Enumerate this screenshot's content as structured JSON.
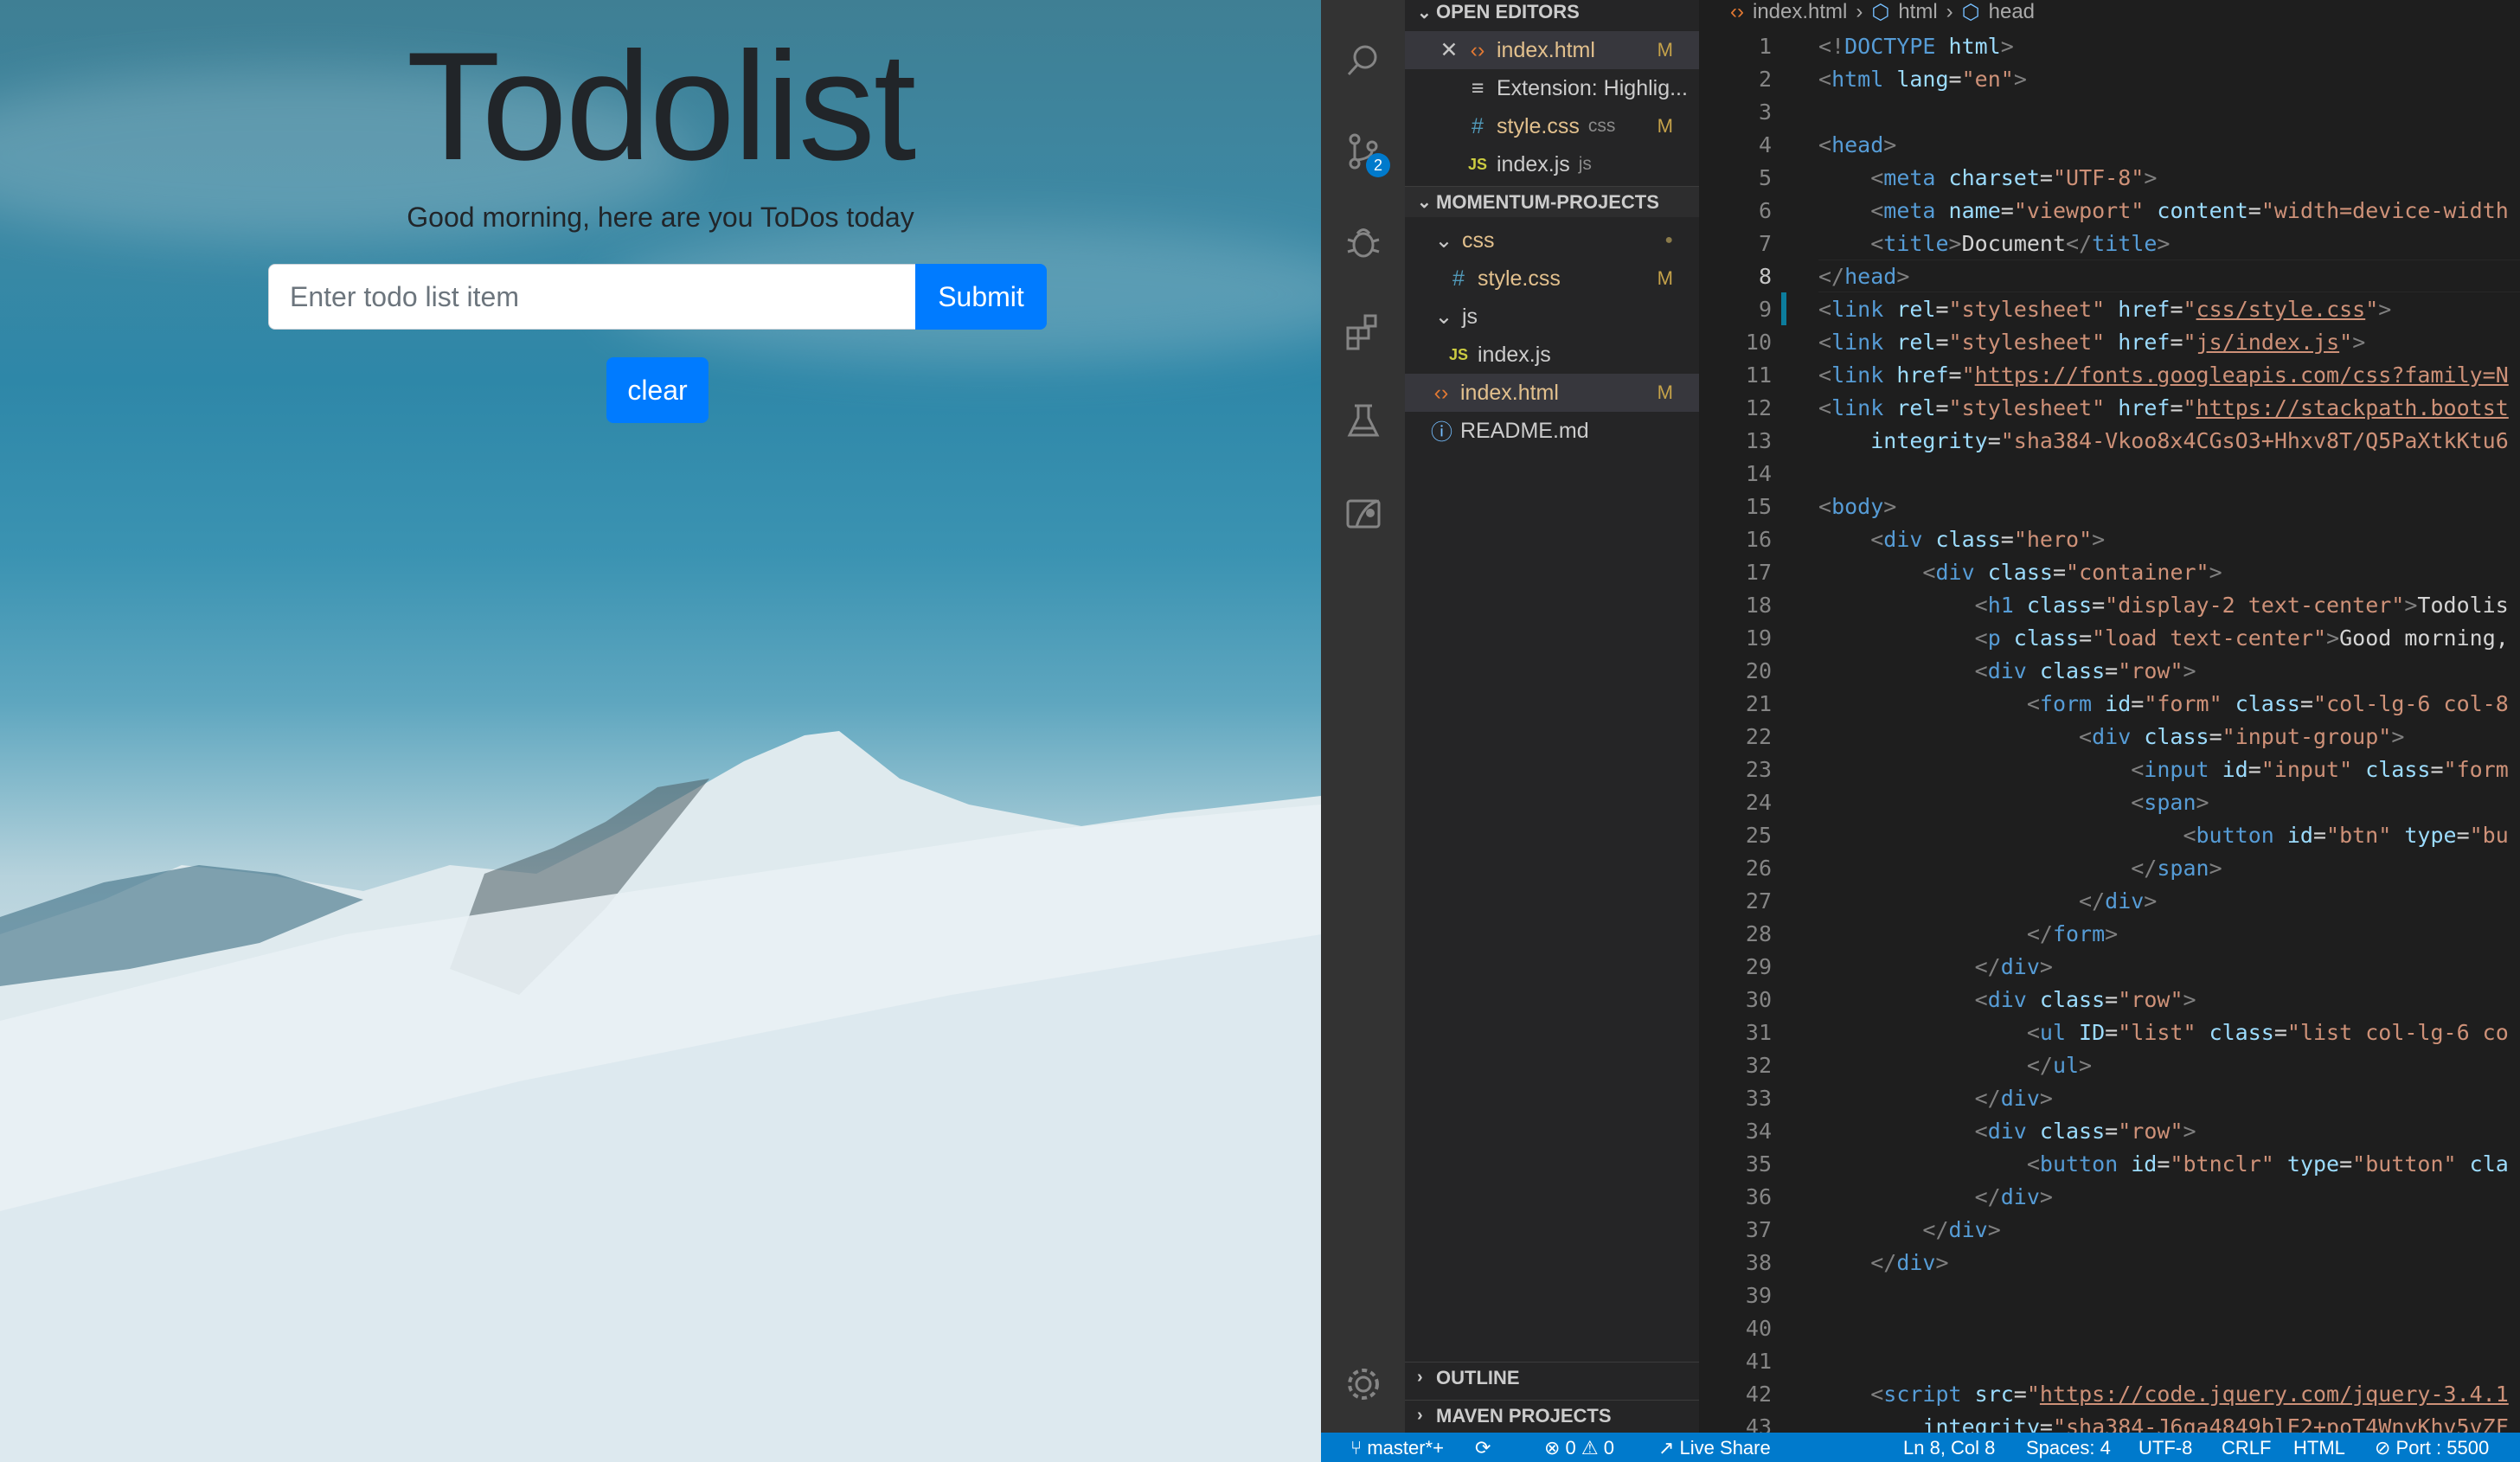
{
  "preview": {
    "title": "Todolist",
    "subtitle": "Good morning, here are you ToDos today",
    "input_placeholder": "Enter todo list item",
    "submit_label": "Submit",
    "clear_label": "clear"
  },
  "colors": {
    "accent": "#007bff",
    "statusbar": "#007acc",
    "editor_bg": "#1e1e1e",
    "sidebar_bg": "#252526"
  },
  "activity_bar": {
    "icons": [
      "search-icon",
      "source-control-icon",
      "debug-icon",
      "extensions-icon",
      "testing-icon",
      "remote-explorer-icon",
      "settings-gear-icon"
    ],
    "source_control_badge": "2"
  },
  "explorer": {
    "open_editors_header": "OPEN EDITORS",
    "open_editors": [
      {
        "name": "index.html",
        "badge": "M",
        "close": "✕"
      },
      {
        "name": "Extension: Highlig...",
        "badge": ""
      },
      {
        "name": "style.css",
        "hint": "css",
        "badge": "M"
      },
      {
        "name": "index.js",
        "hint": "js",
        "badge": ""
      }
    ],
    "project_header": "MOMENTUM-PROJECTS",
    "tree": [
      {
        "name": "css",
        "badge": "●"
      },
      {
        "name": "style.css",
        "badge": "M"
      },
      {
        "name": "js",
        "badge": ""
      },
      {
        "name": "index.js",
        "badge": ""
      },
      {
        "name": "index.html",
        "badge": "M"
      },
      {
        "name": "README.md",
        "badge": ""
      }
    ],
    "outline_header": "OUTLINE",
    "maven_header": "MAVEN PROJECTS"
  },
  "breadcrumbs": [
    "index.html",
    "html",
    "head"
  ],
  "code_lines": [
    [
      [
        "pu",
        "<!"
      ],
      [
        "t",
        "DOCTYPE "
      ],
      [
        "a",
        "html"
      ],
      [
        "pu",
        ">"
      ]
    ],
    [
      [
        "pu",
        "<"
      ],
      [
        "t",
        "html "
      ],
      [
        "a",
        "lang"
      ],
      [
        "tx",
        "="
      ],
      [
        "s",
        "\"en\""
      ],
      [
        "pu",
        ">"
      ]
    ],
    [],
    [
      [
        "pu",
        "<"
      ],
      [
        "t",
        "head"
      ],
      [
        "pu",
        ">"
      ]
    ],
    [
      [
        "tx",
        "    "
      ],
      [
        "pu",
        "<"
      ],
      [
        "t",
        "meta "
      ],
      [
        "a",
        "charset"
      ],
      [
        "tx",
        "="
      ],
      [
        "s",
        "\"UTF-8\""
      ],
      [
        "pu",
        ">"
      ]
    ],
    [
      [
        "tx",
        "    "
      ],
      [
        "pu",
        "<"
      ],
      [
        "t",
        "meta "
      ],
      [
        "a",
        "name"
      ],
      [
        "tx",
        "="
      ],
      [
        "s",
        "\"viewport\" "
      ],
      [
        "a",
        "content"
      ],
      [
        "tx",
        "="
      ],
      [
        "s",
        "\"width=device-width"
      ]
    ],
    [
      [
        "tx",
        "    "
      ],
      [
        "pu",
        "<"
      ],
      [
        "t",
        "title"
      ],
      [
        "pu",
        ">"
      ],
      [
        "tx",
        "Document"
      ],
      [
        "pu",
        "</"
      ],
      [
        "t",
        "title"
      ],
      [
        "pu",
        ">"
      ]
    ],
    [
      [
        "pu",
        "</"
      ],
      [
        "t",
        "head"
      ],
      [
        "pu",
        ">"
      ]
    ],
    [
      [
        "pu",
        "<"
      ],
      [
        "t",
        "link "
      ],
      [
        "a",
        "rel"
      ],
      [
        "tx",
        "="
      ],
      [
        "s",
        "\"stylesheet\" "
      ],
      [
        "a",
        "href"
      ],
      [
        "tx",
        "="
      ],
      [
        "s",
        "\""
      ],
      [
        "u",
        "css/style.css"
      ],
      [
        "s",
        "\""
      ],
      [
        "pu",
        ">"
      ]
    ],
    [
      [
        "pu",
        "<"
      ],
      [
        "t",
        "link "
      ],
      [
        "a",
        "rel"
      ],
      [
        "tx",
        "="
      ],
      [
        "s",
        "\"stylesheet\" "
      ],
      [
        "a",
        "href"
      ],
      [
        "tx",
        "="
      ],
      [
        "s",
        "\""
      ],
      [
        "u",
        "js/index.js"
      ],
      [
        "s",
        "\""
      ],
      [
        "pu",
        ">"
      ]
    ],
    [
      [
        "pu",
        "<"
      ],
      [
        "t",
        "link "
      ],
      [
        "a",
        "href"
      ],
      [
        "tx",
        "="
      ],
      [
        "s",
        "\""
      ],
      [
        "u",
        "https://fonts.googleapis.com/css?family=N"
      ]
    ],
    [
      [
        "pu",
        "<"
      ],
      [
        "t",
        "link "
      ],
      [
        "a",
        "rel"
      ],
      [
        "tx",
        "="
      ],
      [
        "s",
        "\"stylesheet\" "
      ],
      [
        "a",
        "href"
      ],
      [
        "tx",
        "="
      ],
      [
        "s",
        "\""
      ],
      [
        "u",
        "https://stackpath.bootst"
      ]
    ],
    [
      [
        "tx",
        "    "
      ],
      [
        "a",
        "integrity"
      ],
      [
        "tx",
        "="
      ],
      [
        "s",
        "\"sha384-Vkoo8x4CGsO3+Hhxv8T/Q5PaXtkKtu6"
      ]
    ],
    [],
    [
      [
        "pu",
        "<"
      ],
      [
        "t",
        "body"
      ],
      [
        "pu",
        ">"
      ]
    ],
    [
      [
        "tx",
        "    "
      ],
      [
        "pu",
        "<"
      ],
      [
        "t",
        "div "
      ],
      [
        "a",
        "class"
      ],
      [
        "tx",
        "="
      ],
      [
        "s",
        "\"hero\""
      ],
      [
        "pu",
        ">"
      ]
    ],
    [
      [
        "tx",
        "        "
      ],
      [
        "pu",
        "<"
      ],
      [
        "t",
        "div "
      ],
      [
        "a",
        "class"
      ],
      [
        "tx",
        "="
      ],
      [
        "s",
        "\"container\""
      ],
      [
        "pu",
        ">"
      ]
    ],
    [
      [
        "tx",
        "            "
      ],
      [
        "pu",
        "<"
      ],
      [
        "t",
        "h1 "
      ],
      [
        "a",
        "class"
      ],
      [
        "tx",
        "="
      ],
      [
        "s",
        "\"display-2 text-center\""
      ],
      [
        "pu",
        ">"
      ],
      [
        "tx",
        "Todolis"
      ]
    ],
    [
      [
        "tx",
        "            "
      ],
      [
        "pu",
        "<"
      ],
      [
        "t",
        "p "
      ],
      [
        "a",
        "class"
      ],
      [
        "tx",
        "="
      ],
      [
        "s",
        "\"load text-center\""
      ],
      [
        "pu",
        ">"
      ],
      [
        "tx",
        "Good morning,"
      ]
    ],
    [
      [
        "tx",
        "            "
      ],
      [
        "pu",
        "<"
      ],
      [
        "t",
        "div "
      ],
      [
        "a",
        "class"
      ],
      [
        "tx",
        "="
      ],
      [
        "s",
        "\"row\""
      ],
      [
        "pu",
        ">"
      ]
    ],
    [
      [
        "tx",
        "                "
      ],
      [
        "pu",
        "<"
      ],
      [
        "t",
        "form "
      ],
      [
        "a",
        "id"
      ],
      [
        "tx",
        "="
      ],
      [
        "s",
        "\"form\" "
      ],
      [
        "a",
        "class"
      ],
      [
        "tx",
        "="
      ],
      [
        "s",
        "\"col-lg-6 col-8"
      ]
    ],
    [
      [
        "tx",
        "                    "
      ],
      [
        "pu",
        "<"
      ],
      [
        "t",
        "div "
      ],
      [
        "a",
        "class"
      ],
      [
        "tx",
        "="
      ],
      [
        "s",
        "\"input-group\""
      ],
      [
        "pu",
        ">"
      ]
    ],
    [
      [
        "tx",
        "                        "
      ],
      [
        "pu",
        "<"
      ],
      [
        "t",
        "input "
      ],
      [
        "a",
        "id"
      ],
      [
        "tx",
        "="
      ],
      [
        "s",
        "\"input\" "
      ],
      [
        "a",
        "class"
      ],
      [
        "tx",
        "="
      ],
      [
        "s",
        "\"form"
      ]
    ],
    [
      [
        "tx",
        "                        "
      ],
      [
        "pu",
        "<"
      ],
      [
        "t",
        "span"
      ],
      [
        "pu",
        ">"
      ]
    ],
    [
      [
        "tx",
        "                            "
      ],
      [
        "pu",
        "<"
      ],
      [
        "t",
        "button "
      ],
      [
        "a",
        "id"
      ],
      [
        "tx",
        "="
      ],
      [
        "s",
        "\"btn\" "
      ],
      [
        "a",
        "type"
      ],
      [
        "tx",
        "="
      ],
      [
        "s",
        "\"bu"
      ]
    ],
    [
      [
        "tx",
        "                        "
      ],
      [
        "pu",
        "</"
      ],
      [
        "t",
        "span"
      ],
      [
        "pu",
        ">"
      ]
    ],
    [
      [
        "tx",
        "                    "
      ],
      [
        "pu",
        "</"
      ],
      [
        "t",
        "div"
      ],
      [
        "pu",
        ">"
      ]
    ],
    [
      [
        "tx",
        "                "
      ],
      [
        "pu",
        "</"
      ],
      [
        "t",
        "form"
      ],
      [
        "pu",
        ">"
      ]
    ],
    [
      [
        "tx",
        "            "
      ],
      [
        "pu",
        "</"
      ],
      [
        "t",
        "div"
      ],
      [
        "pu",
        ">"
      ]
    ],
    [
      [
        "tx",
        "            "
      ],
      [
        "pu",
        "<"
      ],
      [
        "t",
        "div "
      ],
      [
        "a",
        "class"
      ],
      [
        "tx",
        "="
      ],
      [
        "s",
        "\"row\""
      ],
      [
        "pu",
        ">"
      ]
    ],
    [
      [
        "tx",
        "                "
      ],
      [
        "pu",
        "<"
      ],
      [
        "t",
        "ul "
      ],
      [
        "a",
        "ID"
      ],
      [
        "tx",
        "="
      ],
      [
        "s",
        "\"list\" "
      ],
      [
        "a",
        "class"
      ],
      [
        "tx",
        "="
      ],
      [
        "s",
        "\"list col-lg-6 co"
      ]
    ],
    [
      [
        "tx",
        "                "
      ],
      [
        "pu",
        "</"
      ],
      [
        "t",
        "ul"
      ],
      [
        "pu",
        ">"
      ]
    ],
    [
      [
        "tx",
        "            "
      ],
      [
        "pu",
        "</"
      ],
      [
        "t",
        "div"
      ],
      [
        "pu",
        ">"
      ]
    ],
    [
      [
        "tx",
        "            "
      ],
      [
        "pu",
        "<"
      ],
      [
        "t",
        "div "
      ],
      [
        "a",
        "class"
      ],
      [
        "tx",
        "="
      ],
      [
        "s",
        "\"row\""
      ],
      [
        "pu",
        ">"
      ]
    ],
    [
      [
        "tx",
        "                "
      ],
      [
        "pu",
        "<"
      ],
      [
        "t",
        "button "
      ],
      [
        "a",
        "id"
      ],
      [
        "tx",
        "="
      ],
      [
        "s",
        "\"btnclr\" "
      ],
      [
        "a",
        "type"
      ],
      [
        "tx",
        "="
      ],
      [
        "s",
        "\"button\" "
      ],
      [
        "a",
        "cla"
      ]
    ],
    [
      [
        "tx",
        "            "
      ],
      [
        "pu",
        "</"
      ],
      [
        "t",
        "div"
      ],
      [
        "pu",
        ">"
      ]
    ],
    [
      [
        "tx",
        "        "
      ],
      [
        "pu",
        "</"
      ],
      [
        "t",
        "div"
      ],
      [
        "pu",
        ">"
      ]
    ],
    [
      [
        "tx",
        "    "
      ],
      [
        "pu",
        "</"
      ],
      [
        "t",
        "div"
      ],
      [
        "pu",
        ">"
      ]
    ],
    [],
    [],
    [],
    [
      [
        "tx",
        "    "
      ],
      [
        "pu",
        "<"
      ],
      [
        "t",
        "script "
      ],
      [
        "a",
        "src"
      ],
      [
        "tx",
        "="
      ],
      [
        "s",
        "\""
      ],
      [
        "u",
        "https://code.jquery.com/jquery-3.4.1"
      ]
    ],
    [
      [
        "tx",
        "        "
      ],
      [
        "a",
        "integrity"
      ],
      [
        "tx",
        "="
      ],
      [
        "s",
        "\"sha384-J6qa4849blE2+poT4WnyKhv5vZF"
      ]
    ]
  ],
  "statusbar": {
    "branch": "master*+",
    "errors": "0",
    "warnings": "0",
    "live_share": "Live Share",
    "position": "Ln 8, Col 8",
    "spaces": "Spaces: 4",
    "encoding": "UTF-8",
    "eol": "CRLF",
    "language": "HTML",
    "port": "Port : 5500"
  }
}
